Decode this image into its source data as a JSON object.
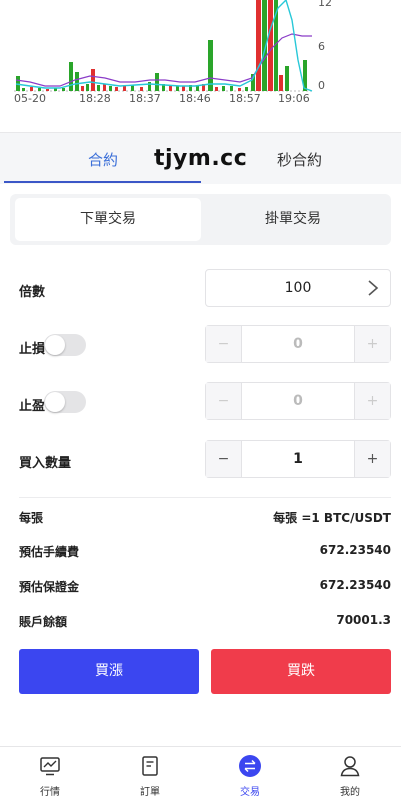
{
  "chart": {
    "x_labels": [
      "05-20",
      "18:28",
      "18:37",
      "18:46",
      "18:57",
      "19:06"
    ],
    "y_labels": [
      "12",
      "6",
      "0"
    ],
    "colors": {
      "up": "#2aa52a",
      "down": "#e03030",
      "line_cyan": "#28c8d8",
      "line_purple": "#8a3cc8"
    }
  },
  "tabs": {
    "contract": "合約",
    "second_contract": "秒合約"
  },
  "watermark": "tjym.cc",
  "order_type": {
    "market": "下單交易",
    "limit": "掛單交易"
  },
  "form": {
    "multiplier_label": "倍數",
    "multiplier_value": "100",
    "stop_loss_label": "止損",
    "stop_loss_value": "0",
    "take_profit_label": "止盈",
    "take_profit_value": "0",
    "quantity_label": "買入數量",
    "quantity_value": "1",
    "minus": "−",
    "plus": "+"
  },
  "info": {
    "per_contract_label": "每張",
    "per_contract_value": "每張 =1 BTC/USDT",
    "fee_label": "預估手續費",
    "fee_value": "672.23540",
    "margin_label": "預估保證金",
    "margin_value": "672.23540",
    "balance_label": "賬戶餘額",
    "balance_value": "70001.3"
  },
  "actions": {
    "buy_label": "買漲",
    "sell_label": "買跌",
    "buy_color": "#3b46f0",
    "sell_color": "#f03c4b"
  },
  "nav": {
    "items": [
      {
        "label": "行情",
        "icon": "chart-monitor-icon"
      },
      {
        "label": "訂單",
        "icon": "document-icon"
      },
      {
        "label": "交易",
        "icon": "swap-icon"
      },
      {
        "label": "我的",
        "icon": "user-icon"
      }
    ],
    "active_color": "#3b46f0"
  }
}
